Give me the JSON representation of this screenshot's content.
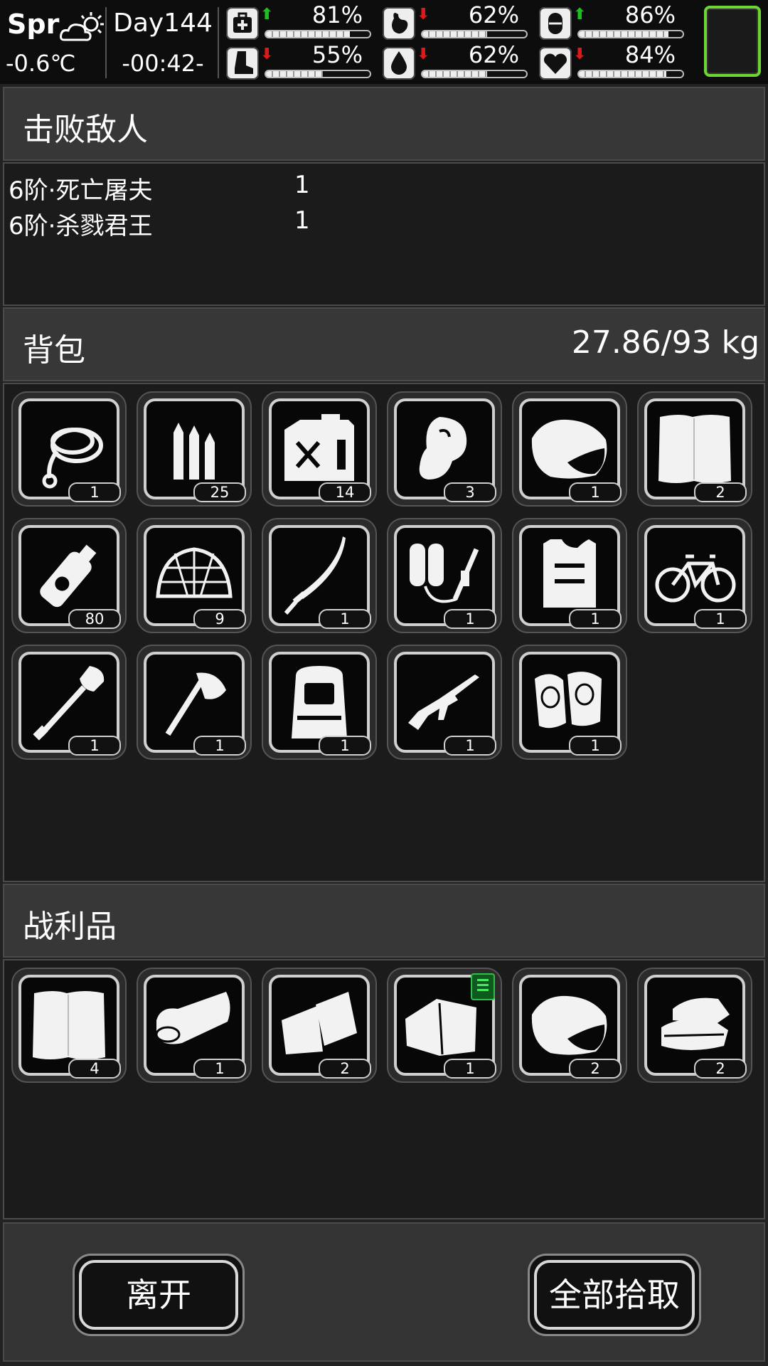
{
  "status": {
    "season": "Spr",
    "weather_icon": "partly-cloudy-sun-icon",
    "temperature": "-0.6℃",
    "day": "Day144",
    "time": "-00:42-",
    "stats": [
      {
        "icon": "medkit-icon",
        "trend": "up",
        "value": "81%",
        "level": 0.81
      },
      {
        "icon": "stomach-icon",
        "trend": "down",
        "value": "62%",
        "level": 0.62
      },
      {
        "icon": "capsule-icon",
        "trend": "up",
        "value": "86%",
        "level": 0.86
      },
      {
        "icon": "boot-icon",
        "trend": "down",
        "value": "55%",
        "level": 0.55
      },
      {
        "icon": "water-drop-icon",
        "trend": "down",
        "value": "62%",
        "level": 0.62
      },
      {
        "icon": "heart-icon",
        "trend": "down",
        "value": "84%",
        "level": 0.84
      }
    ],
    "arrow_up": "⬆",
    "arrow_down": "⬇",
    "colors": {
      "trend_up": "#1ec01e",
      "trend_down": "#e01818",
      "highlight": "#6ed632"
    }
  },
  "defeated": {
    "title": "击败敌人",
    "enemies": [
      {
        "name": "6阶·死亡屠夫",
        "count": "1"
      },
      {
        "name": "6阶·杀戮君王",
        "count": "1"
      }
    ]
  },
  "backpack": {
    "title": "背包",
    "weight": "27.86/93 kg",
    "items": [
      {
        "icon": "rope-icon",
        "count": "1"
      },
      {
        "icon": "bullets-icon",
        "count": "25"
      },
      {
        "icon": "fuel-can-icon",
        "count": "14"
      },
      {
        "icon": "meat-steak-icon",
        "count": "3"
      },
      {
        "icon": "ore-rock-icon",
        "count": "1"
      },
      {
        "icon": "cloth-icon",
        "count": "2"
      },
      {
        "icon": "spray-bottle-icon",
        "count": "80"
      },
      {
        "icon": "net-icon",
        "count": "9"
      },
      {
        "icon": "katana-icon",
        "count": "1"
      },
      {
        "icon": "flamethrower-icon",
        "count": "1"
      },
      {
        "icon": "armor-vest-icon",
        "count": "1"
      },
      {
        "icon": "bicycle-icon",
        "count": "1"
      },
      {
        "icon": "shovel-icon",
        "count": "1"
      },
      {
        "icon": "axe-icon",
        "count": "1"
      },
      {
        "icon": "backpack-icon",
        "count": "1"
      },
      {
        "icon": "rifle-icon",
        "count": "1"
      },
      {
        "icon": "knee-pads-icon",
        "count": "1"
      }
    ]
  },
  "loot": {
    "title": "战利品",
    "items": [
      {
        "icon": "cloth-icon",
        "count": "4",
        "note": false
      },
      {
        "icon": "rolled-cloth-icon",
        "count": "1",
        "note": false
      },
      {
        "icon": "fabric-pieces-icon",
        "count": "2",
        "note": false
      },
      {
        "icon": "torn-cloth-icon",
        "count": "1",
        "note": true
      },
      {
        "icon": "ore-rock-icon",
        "count": "2",
        "note": false
      },
      {
        "icon": "folded-cloth-icon",
        "count": "2",
        "note": false
      }
    ]
  },
  "actions": {
    "leave_label": "离开",
    "take_all_label": "全部拾取"
  }
}
